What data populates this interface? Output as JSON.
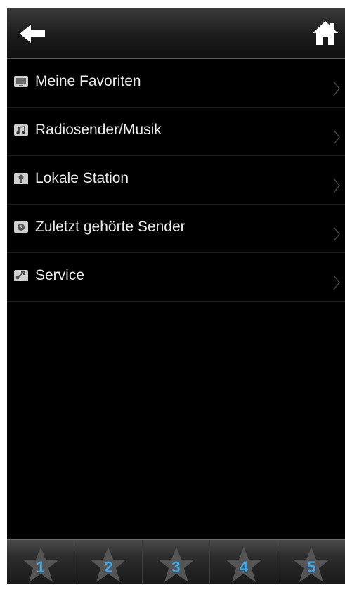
{
  "header": {
    "back_icon": "back-arrow-icon",
    "home_icon": "home-icon"
  },
  "menu": {
    "items": [
      {
        "label": "Meine Favoriten",
        "icon": "favorites-icon"
      },
      {
        "label": "Radiosender/Musik",
        "icon": "music-icon"
      },
      {
        "label": "Lokale Station",
        "icon": "local-station-icon"
      },
      {
        "label": "Zuletzt gehörte Sender",
        "icon": "recent-icon"
      },
      {
        "label": "Service",
        "icon": "service-icon"
      }
    ]
  },
  "presets": {
    "labels": [
      "1",
      "2",
      "3",
      "4",
      "5"
    ],
    "number_color": "#3ea8e8"
  }
}
